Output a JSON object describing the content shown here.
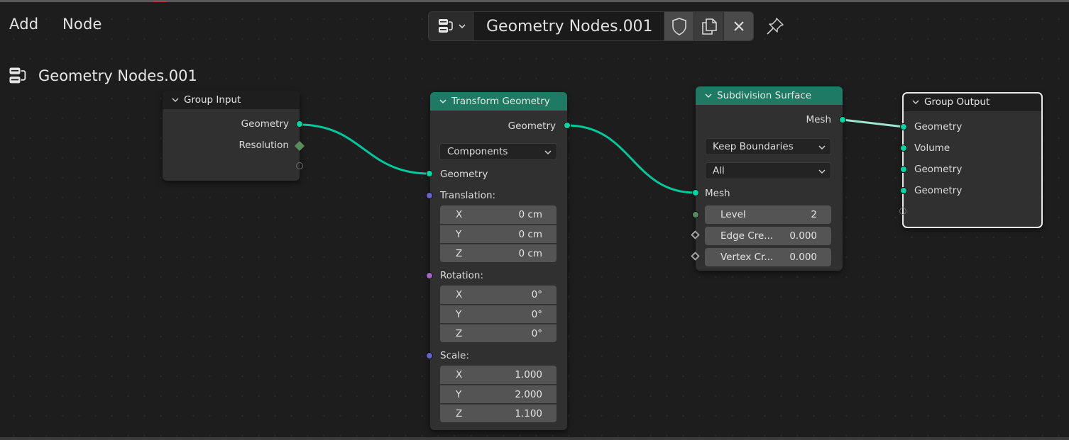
{
  "header": {
    "menus": [
      "Add",
      "Node"
    ],
    "datablock": {
      "type_icon": "node-tree-icon",
      "name": "Geometry Nodes.001",
      "buttons": [
        "fake-user-shield-icon",
        "duplicate-icon",
        "close-icon"
      ]
    },
    "pin_icon": "pin-icon"
  },
  "breadcrumb": {
    "icon": "node-tree-icon",
    "title": "Geometry Nodes.001"
  },
  "colors": {
    "geometry_socket": "#00d6a3",
    "vector_socket": "#6363c7",
    "rotation_socket": "#a663c7",
    "integer_socket": "#598c5c",
    "geometry_node_header": "#1e7a62",
    "link": "#00d6a3"
  },
  "nodes": {
    "group_input": {
      "title": "Group Input",
      "outputs": [
        "Geometry",
        "Resolution"
      ]
    },
    "transform": {
      "title": "Transform Geometry",
      "output": "Geometry",
      "mode": "Components",
      "input_geometry": "Geometry",
      "translation": {
        "label": "Translation:",
        "x": {
          "axis": "X",
          "value": "0 cm"
        },
        "y": {
          "axis": "Y",
          "value": "0 cm"
        },
        "z": {
          "axis": "Z",
          "value": "0 cm"
        }
      },
      "rotation": {
        "label": "Rotation:",
        "x": {
          "axis": "X",
          "value": "0°"
        },
        "y": {
          "axis": "Y",
          "value": "0°"
        },
        "z": {
          "axis": "Z",
          "value": "0°"
        }
      },
      "scale": {
        "label": "Scale:",
        "x": {
          "axis": "X",
          "value": "1.000"
        },
        "y": {
          "axis": "Y",
          "value": "2.000"
        },
        "z": {
          "axis": "Z",
          "value": "1.100"
        }
      }
    },
    "subdivision": {
      "title": "Subdivision Surface",
      "output": "Mesh",
      "uv_smooth": "Keep Boundaries",
      "boundary_smooth": "All",
      "input_mesh": "Mesh",
      "level": {
        "label": "Level",
        "value": "2"
      },
      "edge_crease": {
        "label": "Edge Cre...",
        "value": "0.000"
      },
      "vertex_crease": {
        "label": "Vertex Cr...",
        "value": "0.000"
      }
    },
    "group_output": {
      "title": "Group Output",
      "inputs": [
        "Geometry",
        "Volume",
        "Geometry",
        "Geometry"
      ]
    }
  }
}
